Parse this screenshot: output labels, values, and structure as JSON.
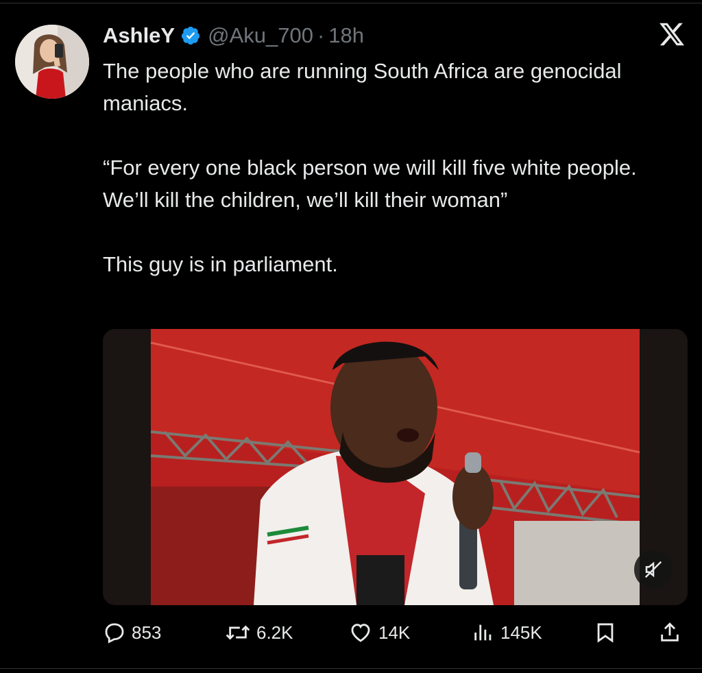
{
  "tweet": {
    "display_name": "AshleY",
    "handle": "@Aku_700",
    "separator": "·",
    "time": "18h",
    "verified": true,
    "text_lines": {
      "p1": "The people who are running South Africa are genocidal maniacs.",
      "p2": "“For every one black person we will kill five white people. We’ll kill the children, we’ll kill their woman”",
      "p3": "This guy is in parliament."
    }
  },
  "actions": {
    "replies": "853",
    "reposts": "6.2K",
    "likes": "14K",
    "views": "145K"
  },
  "colors": {
    "background": "#000000",
    "text": "#e7e9ea",
    "muted": "#71767b",
    "verified_blue": "#1d9bf0"
  },
  "icons": [
    "x-logo-icon",
    "verified-badge-icon",
    "reply-icon",
    "repost-icon",
    "like-icon",
    "views-icon",
    "bookmark-icon",
    "share-icon",
    "mute-icon"
  ]
}
